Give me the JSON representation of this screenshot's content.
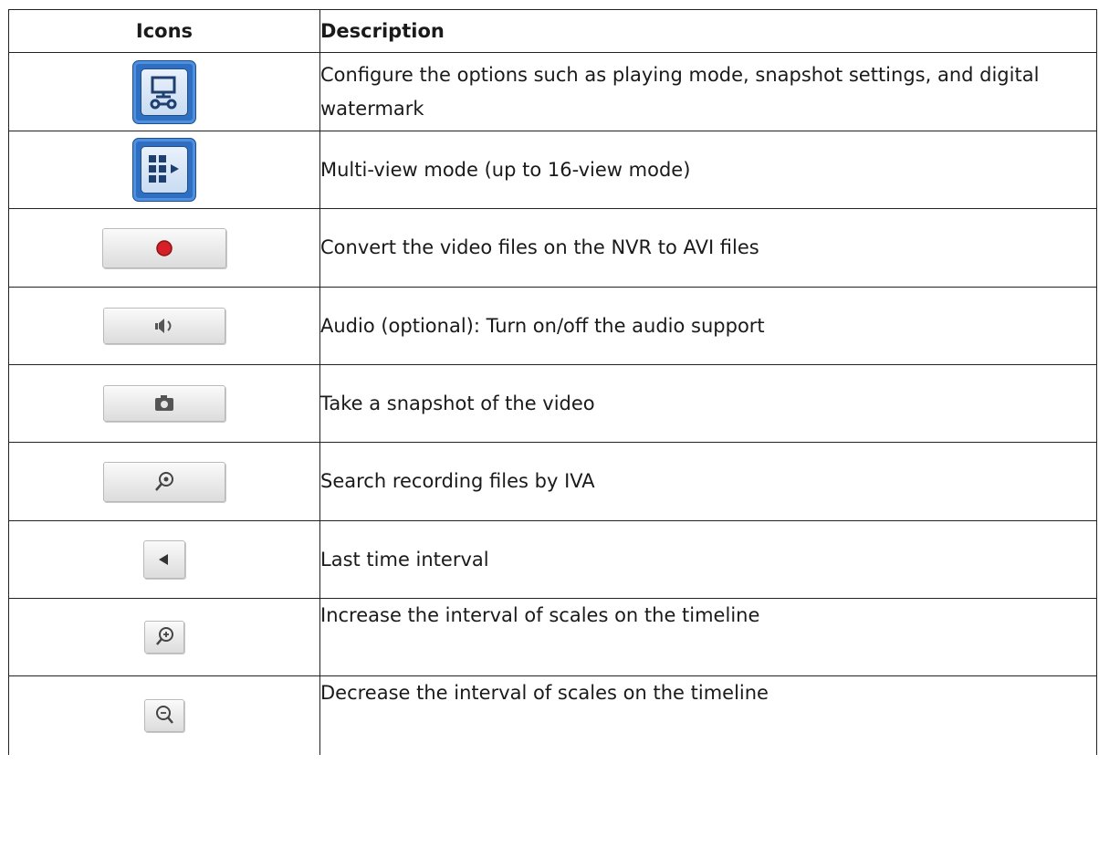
{
  "header": {
    "icons": "Icons",
    "description": "Description"
  },
  "rows": [
    {
      "icon": "configure-options-icon",
      "description": "Configure the options such as playing mode, snapshot settings, and digital watermark"
    },
    {
      "icon": "multi-view-icon",
      "description": "Multi-view mode (up to 16-view mode)"
    },
    {
      "icon": "record-convert-icon",
      "description": "Convert the video files on the NVR to AVI files"
    },
    {
      "icon": "audio-icon",
      "description": "Audio (optional): Turn on/off the audio support"
    },
    {
      "icon": "camera-snapshot-icon",
      "description": "Take a snapshot of the video"
    },
    {
      "icon": "search-iva-icon",
      "description": "Search recording files by IVA"
    },
    {
      "icon": "previous-interval-icon",
      "description": "Last time interval"
    },
    {
      "icon": "zoom-in-icon",
      "description": "Increase the interval of scales on the timeline"
    },
    {
      "icon": "zoom-out-icon",
      "description": "Decrease the interval of scales on the timeline"
    }
  ],
  "colors": {
    "blue_tile": "#2f6fc2",
    "record_red": "#d61f26",
    "border": "#222222"
  }
}
